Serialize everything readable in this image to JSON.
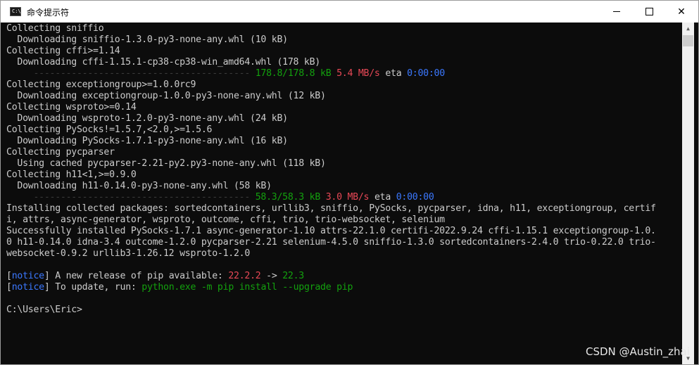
{
  "window": {
    "title": "命令提示符",
    "icon_text": "C:\\",
    "controls": {
      "minimize": "minimize-icon",
      "maximize": "maximize-icon",
      "close": "✕"
    }
  },
  "terminal": {
    "lines": [
      "Collecting sniffio",
      "  Downloading sniffio-1.3.0-py3-none-any.whl (10 kB)",
      "Collecting cffi>=1.14",
      "  Downloading cffi-1.15.1-cp38-cp38-win_amd64.whl (178 kB)",
      {
        "bar": "     ----------------------------------------",
        "size": "178.8/178.8 kB",
        "speed": "5.4 MB/s",
        "eta_label": "eta",
        "eta": "0:00:00"
      },
      "Collecting exceptiongroup>=1.0.0rc9",
      "  Downloading exceptiongroup-1.0.0-py3-none-any.whl (12 kB)",
      "Collecting wsproto>=0.14",
      "  Downloading wsproto-1.2.0-py3-none-any.whl (24 kB)",
      "Collecting PySocks!=1.5.7,<2.0,>=1.5.6",
      "  Downloading PySocks-1.7.1-py3-none-any.whl (16 kB)",
      "Collecting pycparser",
      "  Using cached pycparser-2.21-py2.py3-none-any.whl (118 kB)",
      "Collecting h11<1,>=0.9.0",
      "  Downloading h11-0.14.0-py3-none-any.whl (58 kB)",
      {
        "bar": "     ----------------------------------------",
        "size": "58.3/58.3 kB",
        "speed": "3.0 MB/s",
        "eta_label": "eta",
        "eta": "0:00:00"
      },
      "Installing collected packages: sortedcontainers, urllib3, sniffio, PySocks, pycparser, idna, h11, exceptiongroup, certif",
      "i, attrs, async-generator, wsproto, outcome, cffi, trio, trio-websocket, selenium",
      "Successfully installed PySocks-1.7.1 async-generator-1.10 attrs-22.1.0 certifi-2022.9.24 cffi-1.15.1 exceptiongroup-1.0.",
      "0 h11-0.14.0 idna-3.4 outcome-1.2.0 pycparser-2.21 selenium-4.5.0 sniffio-1.3.0 sortedcontainers-2.4.0 trio-0.22.0 trio-",
      "websocket-0.9.2 urllib3-1.26.12 wsproto-1.2.0",
      "",
      {
        "notice_open": "[",
        "notice": "notice",
        "notice_close": "]",
        "text": " A new release of pip available: ",
        "old": "22.2.2",
        "arrow": " -> ",
        "new": "22.3"
      },
      {
        "notice_open": "[",
        "notice": "notice",
        "notice_close": "]",
        "text": " To update, run: ",
        "cmd": "python.exe -m pip install --upgrade pip"
      },
      "",
      "C:\\Users\\Eric>"
    ]
  },
  "watermark": "CSDN @Austin_zhai",
  "colors": {
    "green": "#13a10e",
    "red": "#e74856",
    "blue": "#3b78ff",
    "text": "#cccccc",
    "background": "#0c0c0c"
  }
}
